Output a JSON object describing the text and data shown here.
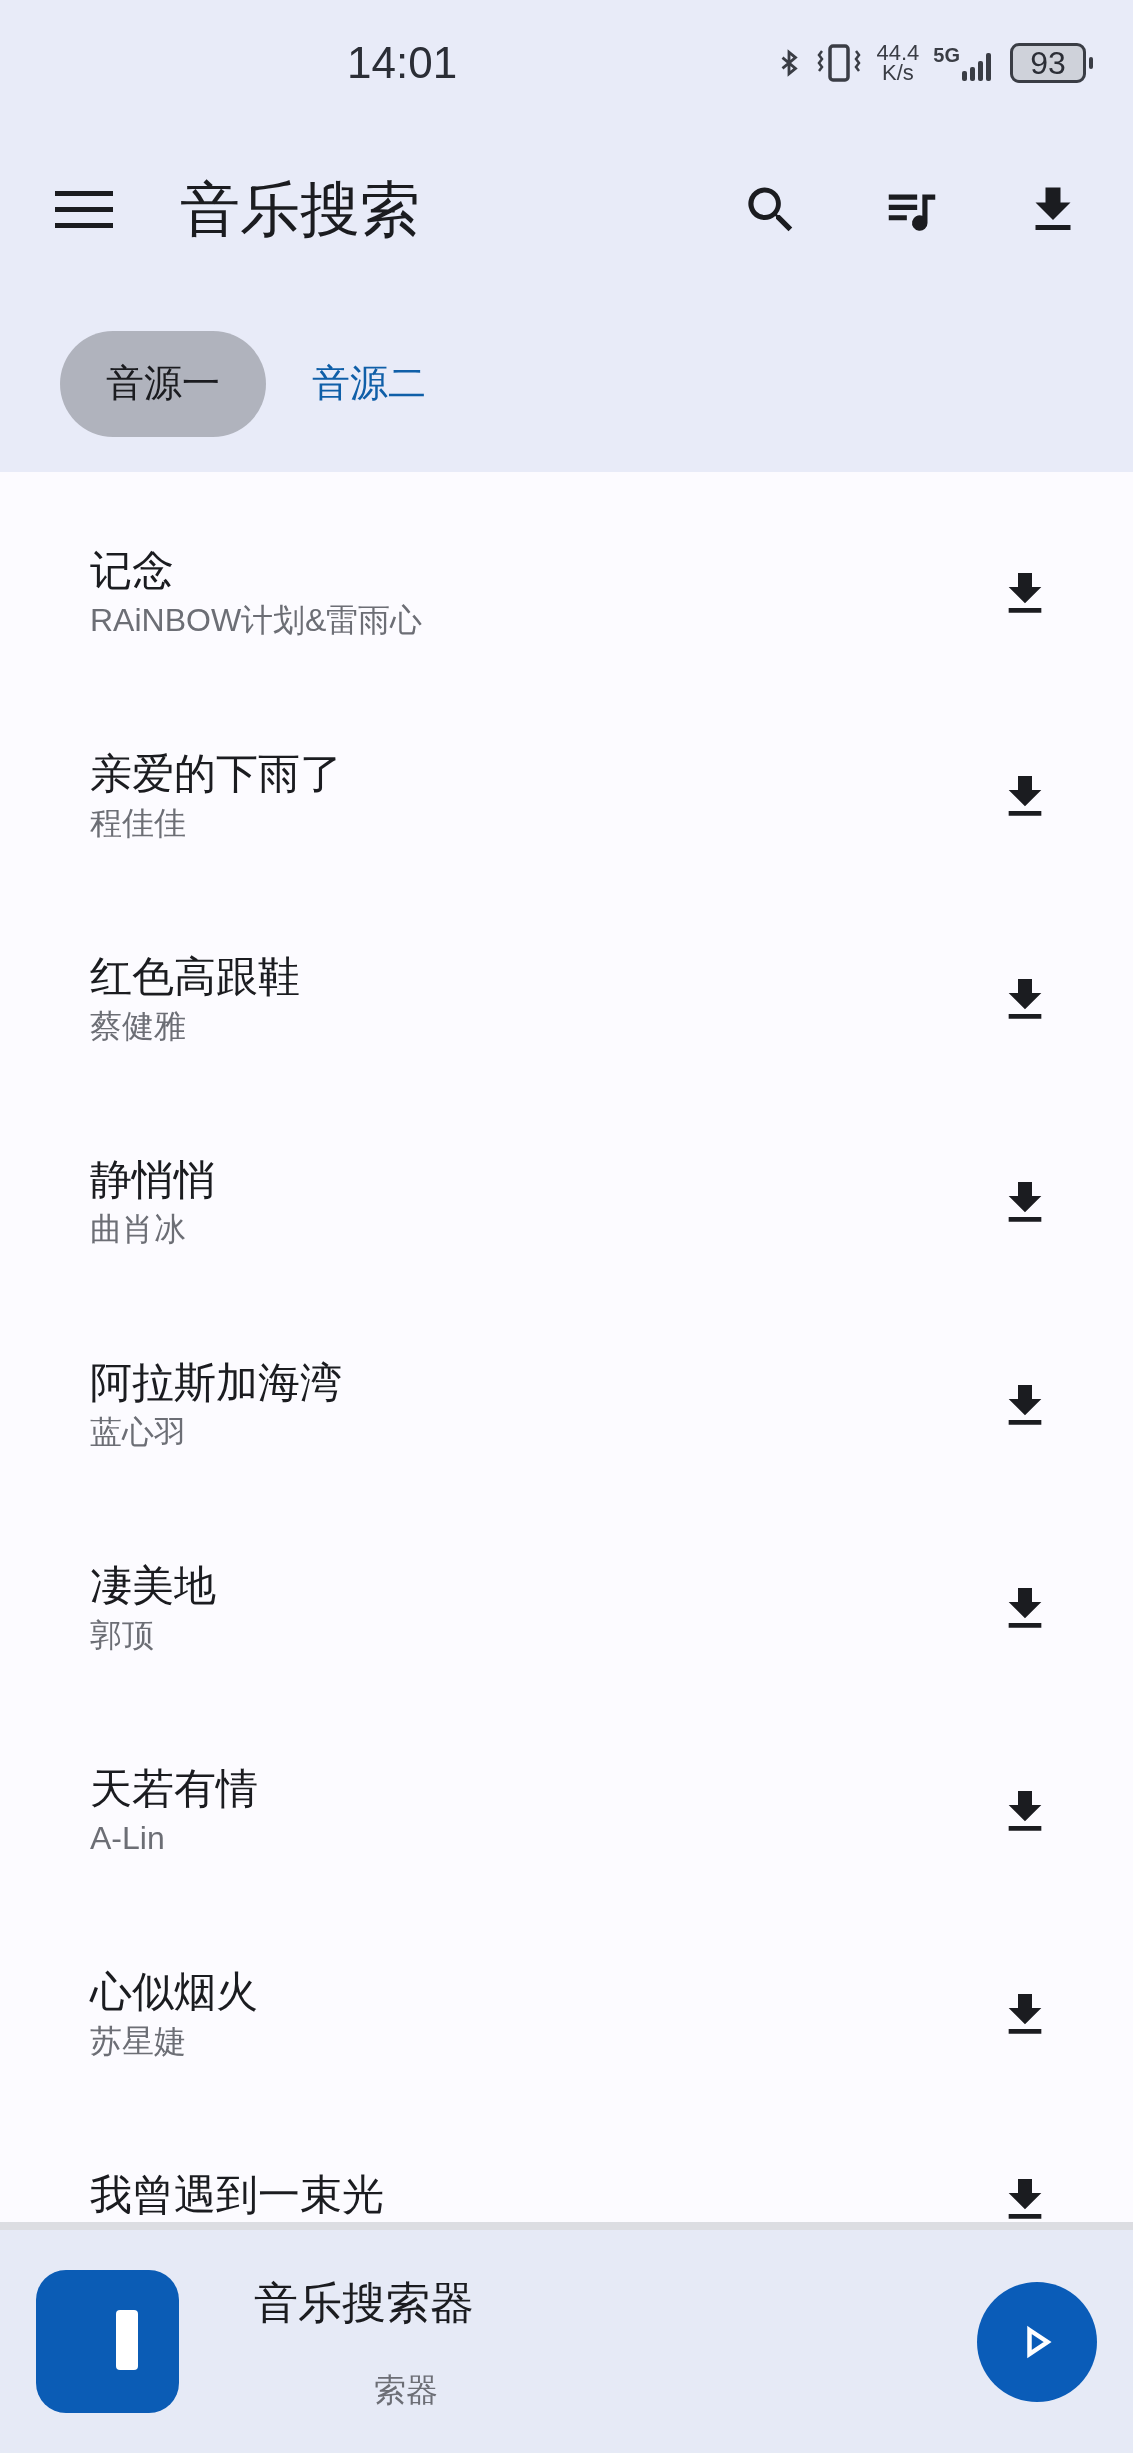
{
  "status_bar": {
    "time": "14:01",
    "net_speed_value": "44.4",
    "net_speed_unit": "K/s",
    "network": "5G",
    "battery": "93"
  },
  "app_bar": {
    "title": "音乐搜索"
  },
  "tabs": [
    {
      "label": "音源一",
      "selected": true
    },
    {
      "label": "音源二",
      "selected": false
    }
  ],
  "songs": [
    {
      "title": "记念",
      "artist": "RAiNBOW计划&雷雨心"
    },
    {
      "title": "亲爱的下雨了",
      "artist": "程佳佳"
    },
    {
      "title": "红色高跟鞋",
      "artist": "蔡健雅"
    },
    {
      "title": "静悄悄",
      "artist": "曲肖冰"
    },
    {
      "title": "阿拉斯加海湾",
      "artist": "蓝心羽"
    },
    {
      "title": "凄美地",
      "artist": "郭顶"
    },
    {
      "title": "天若有情",
      "artist": "A-Lin"
    },
    {
      "title": "心似烟火",
      "artist": "苏星婕"
    },
    {
      "title": "我曾遇到一束光"
    }
  ],
  "player": {
    "title": "音乐搜索器",
    "subtitle": "索器"
  }
}
